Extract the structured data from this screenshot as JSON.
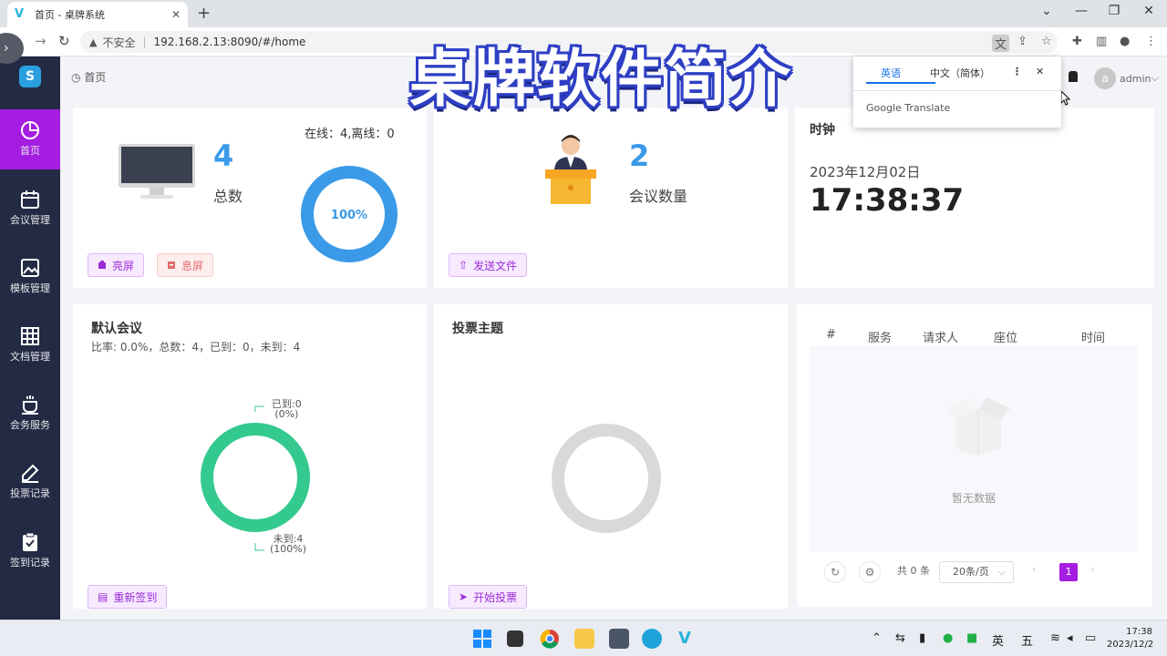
{
  "browser": {
    "tab_title": "首页 - 桌牌系统",
    "tab_close": "✕",
    "new_tab": "+",
    "security_label": "不安全",
    "url": "192.168.2.13:8090/#/home"
  },
  "overlay_banner": "桌牌软件简介",
  "translate_popup": {
    "tab_english": "英语",
    "tab_chinese": "中文（简体）",
    "brand": "Google Translate"
  },
  "header": {
    "breadcrumb": "首页",
    "user": "admin",
    "avatar_letter": "a"
  },
  "sidebar": {
    "items": [
      {
        "label": "首页",
        "icon": "pie-chart-icon"
      },
      {
        "label": "会议管理",
        "icon": "calendar-icon"
      },
      {
        "label": "模板管理",
        "icon": "image-icon"
      },
      {
        "label": "文档管理",
        "icon": "grid-icon"
      },
      {
        "label": "会务服务",
        "icon": "cup-icon"
      },
      {
        "label": "投票记录",
        "icon": "pen-icon"
      },
      {
        "label": "签到记录",
        "icon": "clipboard-icon"
      }
    ]
  },
  "devices_card": {
    "count": "4",
    "count_label": "总数",
    "online_status": "在线：4,离线：0",
    "ring_percent": 100,
    "ring_label": "100%",
    "btn_screen_on": "亮屏",
    "btn_screen_off": "息屏"
  },
  "meetings_card": {
    "count": "2",
    "count_label": "会议数量",
    "btn_send_file": "发送文件"
  },
  "clock_card": {
    "title": "时钟",
    "date": "2023年12月02日",
    "time": "17:38:37"
  },
  "default_meeting_card": {
    "title": "默认会议",
    "stats": "比率: 0.0%，总数：4，已到：0，未到：4",
    "arrived_label": "已到:0",
    "arrived_pct": "(0%)",
    "absent_label": "未到:4",
    "absent_pct": "(100%)",
    "btn_recheck": "重新签到"
  },
  "vote_card": {
    "title": "投票主题",
    "btn_start_vote": "开始投票"
  },
  "service_table": {
    "columns": [
      "#",
      "服务",
      "请求人",
      "座位",
      "时间"
    ],
    "empty_text": "暂无数据",
    "total": "共 0 条",
    "page_size": "20条/页",
    "current_page": "1"
  },
  "chart_data": {
    "type": "pie",
    "categories": [
      "已到",
      "未到"
    ],
    "values": [
      0,
      4
    ]
  },
  "taskbar": {
    "ime_lang": "英",
    "ime_mode": "五",
    "time": "17:38",
    "date": "2023/12/2"
  },
  "colors": {
    "sidebar_bg": "#232a44",
    "active": "#a51de0",
    "blue": "#3a9ae8",
    "green": "#34c98f"
  }
}
